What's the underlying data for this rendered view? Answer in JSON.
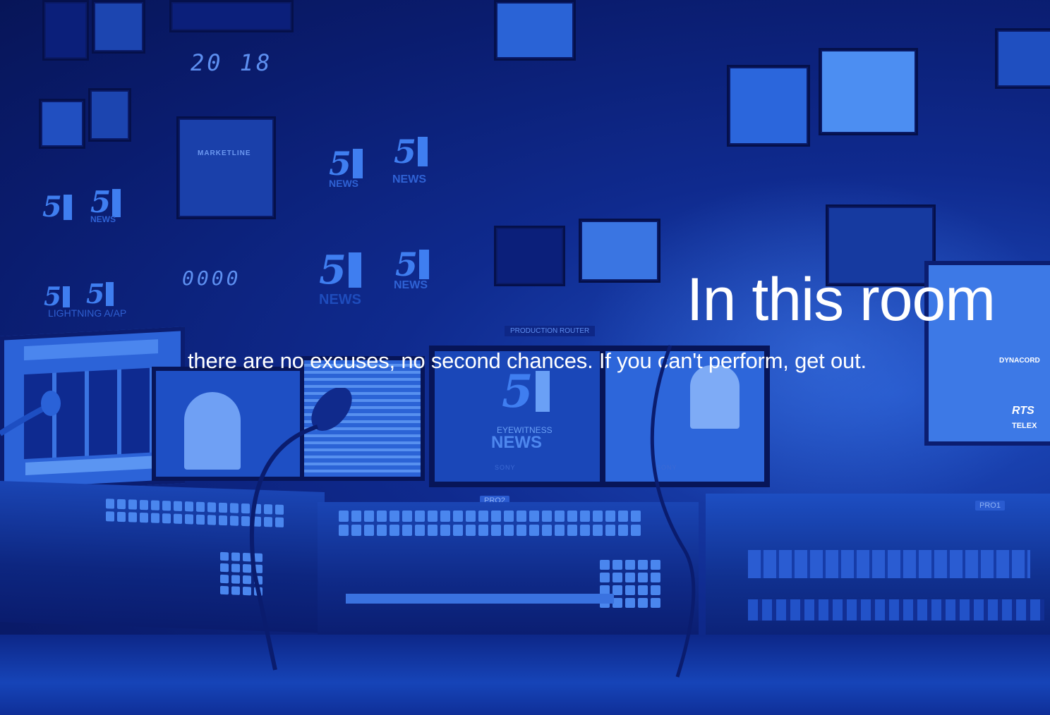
{
  "headline": "In this room",
  "subline": "there are no excuses, no second chances. If you can't perform, get out.",
  "wall": {
    "counter_top": "20 18",
    "counter_bottom": "0000",
    "lightning_label": "LIGHTNING A/AP",
    "marketline_label": "MARKETLINE",
    "channel_number": "5",
    "eyewitness": "EYEWITNESS",
    "news": "NEWS",
    "router_label": "PRODUCTION ROUTER",
    "sony_left": "SONY",
    "sony_right": "SONY",
    "dynacord": "DYNACORD",
    "rts": "RTS",
    "telex": "TELEX",
    "pro2": "PRO2",
    "pro1": "PRO1"
  },
  "colors": {
    "background": "#0f2a8e",
    "highlight": "#3f7ef0",
    "text": "#ffffff"
  }
}
